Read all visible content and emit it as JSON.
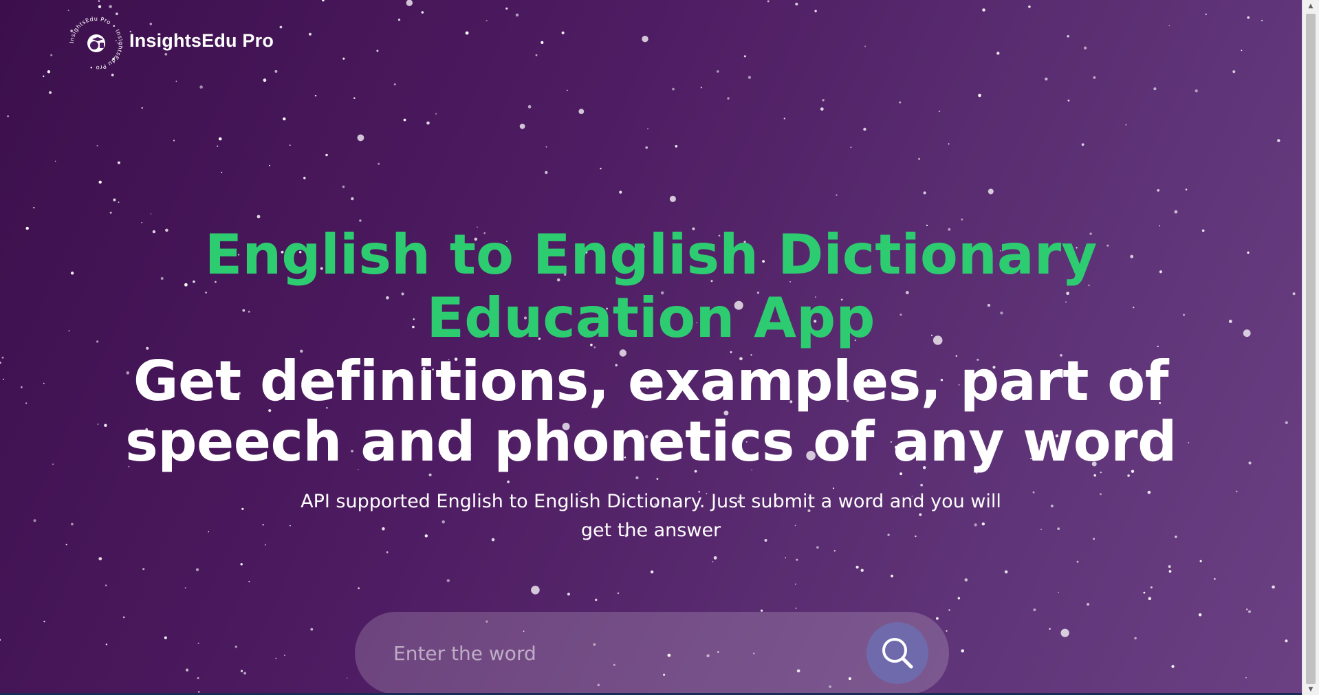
{
  "header": {
    "brand_name": "InsightsEdu Pro",
    "logo_ring_text": "InsightsEdu Pro • InsightsEdu Pro •"
  },
  "hero": {
    "title": "English to English Dictionary Education App",
    "subtitle": "Get definitions, examples, part of speech and phonetics of any word",
    "description": "API supported English to English Dictionary. Just submit a word and you will get the answer"
  },
  "search": {
    "placeholder": "Enter the word",
    "value": "",
    "button_icon": "search-icon"
  },
  "colors": {
    "title_green": "#2ecc71",
    "background_start": "#3c0f4c",
    "background_end": "#6b4184",
    "search_button": "#6f6aab"
  }
}
